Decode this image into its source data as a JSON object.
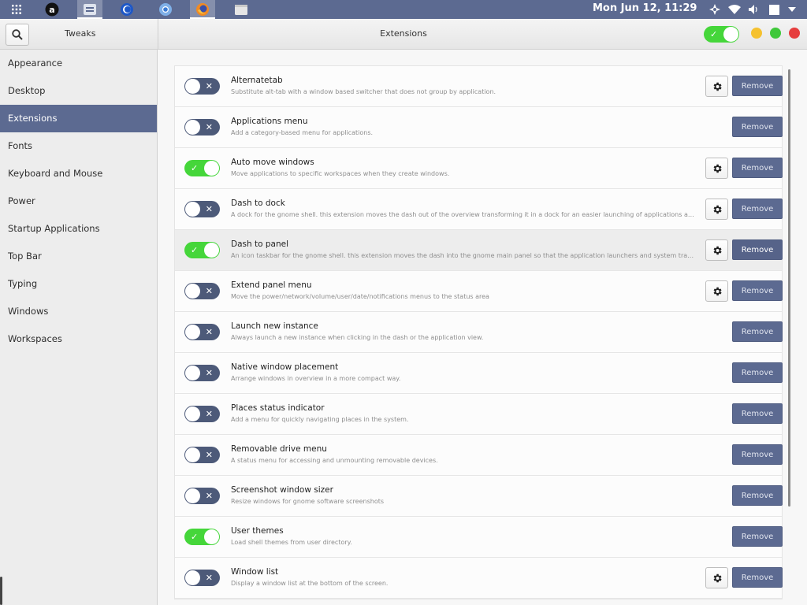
{
  "topbar": {
    "clock": "Mon Jun 12, 11:29",
    "color": "#5c6a91",
    "launchers": [
      "apps-grid-icon",
      "amazon-icon",
      "files-icon",
      "browser-icon",
      "chromium-icon",
      "firefox-icon",
      "folder-icon"
    ],
    "tray": [
      "network-icon",
      "wifi-icon",
      "volume-icon",
      "battery-icon",
      "menu-arrow-icon"
    ]
  },
  "header": {
    "left_title": "Tweaks",
    "title": "Extensions",
    "master_switch": "on",
    "window_buttons": [
      "minimize",
      "maximize",
      "close"
    ]
  },
  "sidebar": {
    "items": [
      {
        "label": "Appearance"
      },
      {
        "label": "Desktop"
      },
      {
        "label": "Extensions",
        "selected": true
      },
      {
        "label": "Fonts"
      },
      {
        "label": "Keyboard and Mouse"
      },
      {
        "label": "Power"
      },
      {
        "label": "Startup Applications"
      },
      {
        "label": "Top Bar"
      },
      {
        "label": "Typing"
      },
      {
        "label": "Windows"
      },
      {
        "label": "Workspaces"
      }
    ]
  },
  "extensions": {
    "remove_label": "Remove",
    "items": [
      {
        "name": "Alternatetab",
        "desc": "Substitute alt-tab with a window based switcher that does not group by application.",
        "enabled": false,
        "has_settings": true
      },
      {
        "name": "Applications menu",
        "desc": "Add a category-based menu for applications.",
        "enabled": false,
        "has_settings": false
      },
      {
        "name": "Auto move windows",
        "desc": "Move applications to specific workspaces when they create windows.",
        "enabled": true,
        "has_settings": true
      },
      {
        "name": "Dash to dock",
        "desc": "A dock for the gnome shell. this extension moves the dash out of the overview transforming it in a dock for an easier launching of applications and a faste...",
        "enabled": false,
        "has_settings": true
      },
      {
        "name": "Dash to panel",
        "desc": "An icon taskbar for the gnome shell. this extension moves the dash into the gnome main panel so that the application launchers and system tray are comb...",
        "enabled": true,
        "has_settings": true,
        "hover": true
      },
      {
        "name": "Extend panel menu",
        "desc": "Move the power/network/volume/user/date/notifications menus to the status area",
        "enabled": false,
        "has_settings": true
      },
      {
        "name": "Launch new instance",
        "desc": "Always launch a new instance when clicking in the dash or the application view.",
        "enabled": false,
        "has_settings": false
      },
      {
        "name": "Native window placement",
        "desc": "Arrange windows in overview in a more compact way.",
        "enabled": false,
        "has_settings": false
      },
      {
        "name": "Places status indicator",
        "desc": "Add a menu for quickly navigating places in the system.",
        "enabled": false,
        "has_settings": false
      },
      {
        "name": "Removable drive menu",
        "desc": "A status menu for accessing and unmounting removable devices.",
        "enabled": false,
        "has_settings": false
      },
      {
        "name": "Screenshot window sizer",
        "desc": "Resize windows for gnome software screenshots",
        "enabled": false,
        "has_settings": false
      },
      {
        "name": "User themes",
        "desc": "Load shell themes from user directory.",
        "enabled": true,
        "has_settings": false
      },
      {
        "name": "Window list",
        "desc": "Display a window list at the bottom of the screen.",
        "enabled": false,
        "has_settings": true
      }
    ]
  },
  "colors": {
    "accent": "#5c6a91",
    "toggle_on": "#45d63a",
    "toggle_off": "#4d5a79",
    "minimize": "#f5c12f",
    "maximize": "#3fc83a",
    "close": "#e63e3e"
  }
}
